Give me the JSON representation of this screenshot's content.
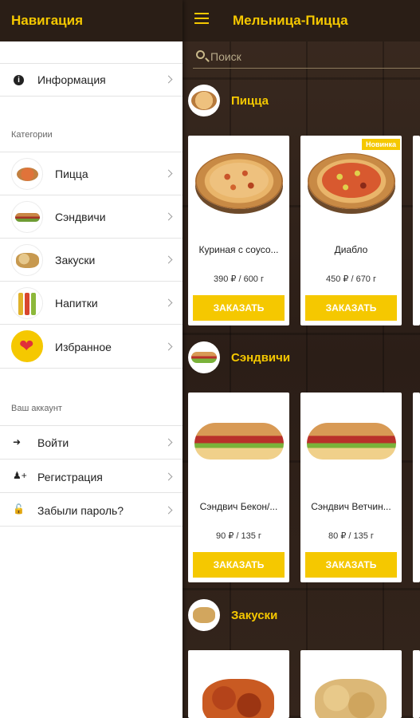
{
  "app": {
    "title": "Мельница-Пицца",
    "search_placeholder": "Поиск"
  },
  "drawer": {
    "title": "Навигация",
    "info_label": "Информация",
    "categories_header": "Категории",
    "categories": [
      {
        "label": "Пицца",
        "icon": "pizza-icon"
      },
      {
        "label": "Сэндвичи",
        "icon": "sandwich-icon"
      },
      {
        "label": "Закуски",
        "icon": "snacks-icon"
      },
      {
        "label": "Напитки",
        "icon": "drinks-icon"
      },
      {
        "label": "Избранное",
        "icon": "heart-icon"
      }
    ],
    "account_header": "Ваш аккаунт",
    "account": [
      {
        "label": "Войти",
        "icon": "login-icon"
      },
      {
        "label": "Регистрация",
        "icon": "add-user-icon"
      },
      {
        "label": "Забыли пароль?",
        "icon": "unlock-icon"
      }
    ]
  },
  "sections": [
    {
      "title": "Пицца",
      "items": [
        {
          "name": "Куриная с соусо...",
          "price": "390 ₽ / 600 г",
          "order": "ЗАКАЗАТЬ"
        },
        {
          "name": "Диабло",
          "price": "450 ₽ / 670 г",
          "order": "ЗАКАЗАТЬ",
          "badge": "Новинка"
        }
      ]
    },
    {
      "title": "Сэндвичи",
      "items": [
        {
          "name": "Сэндвич Бекон/...",
          "price": "90 ₽ / 135 г",
          "order": "ЗАКАЗАТЬ"
        },
        {
          "name": "Сэндвич Ветчин...",
          "price": "80 ₽ / 135 г",
          "order": "ЗАКАЗАТЬ"
        }
      ]
    },
    {
      "title": "Закуски",
      "items": []
    }
  ],
  "colors": {
    "accent": "#f5c800",
    "header": "#2a1e16"
  }
}
